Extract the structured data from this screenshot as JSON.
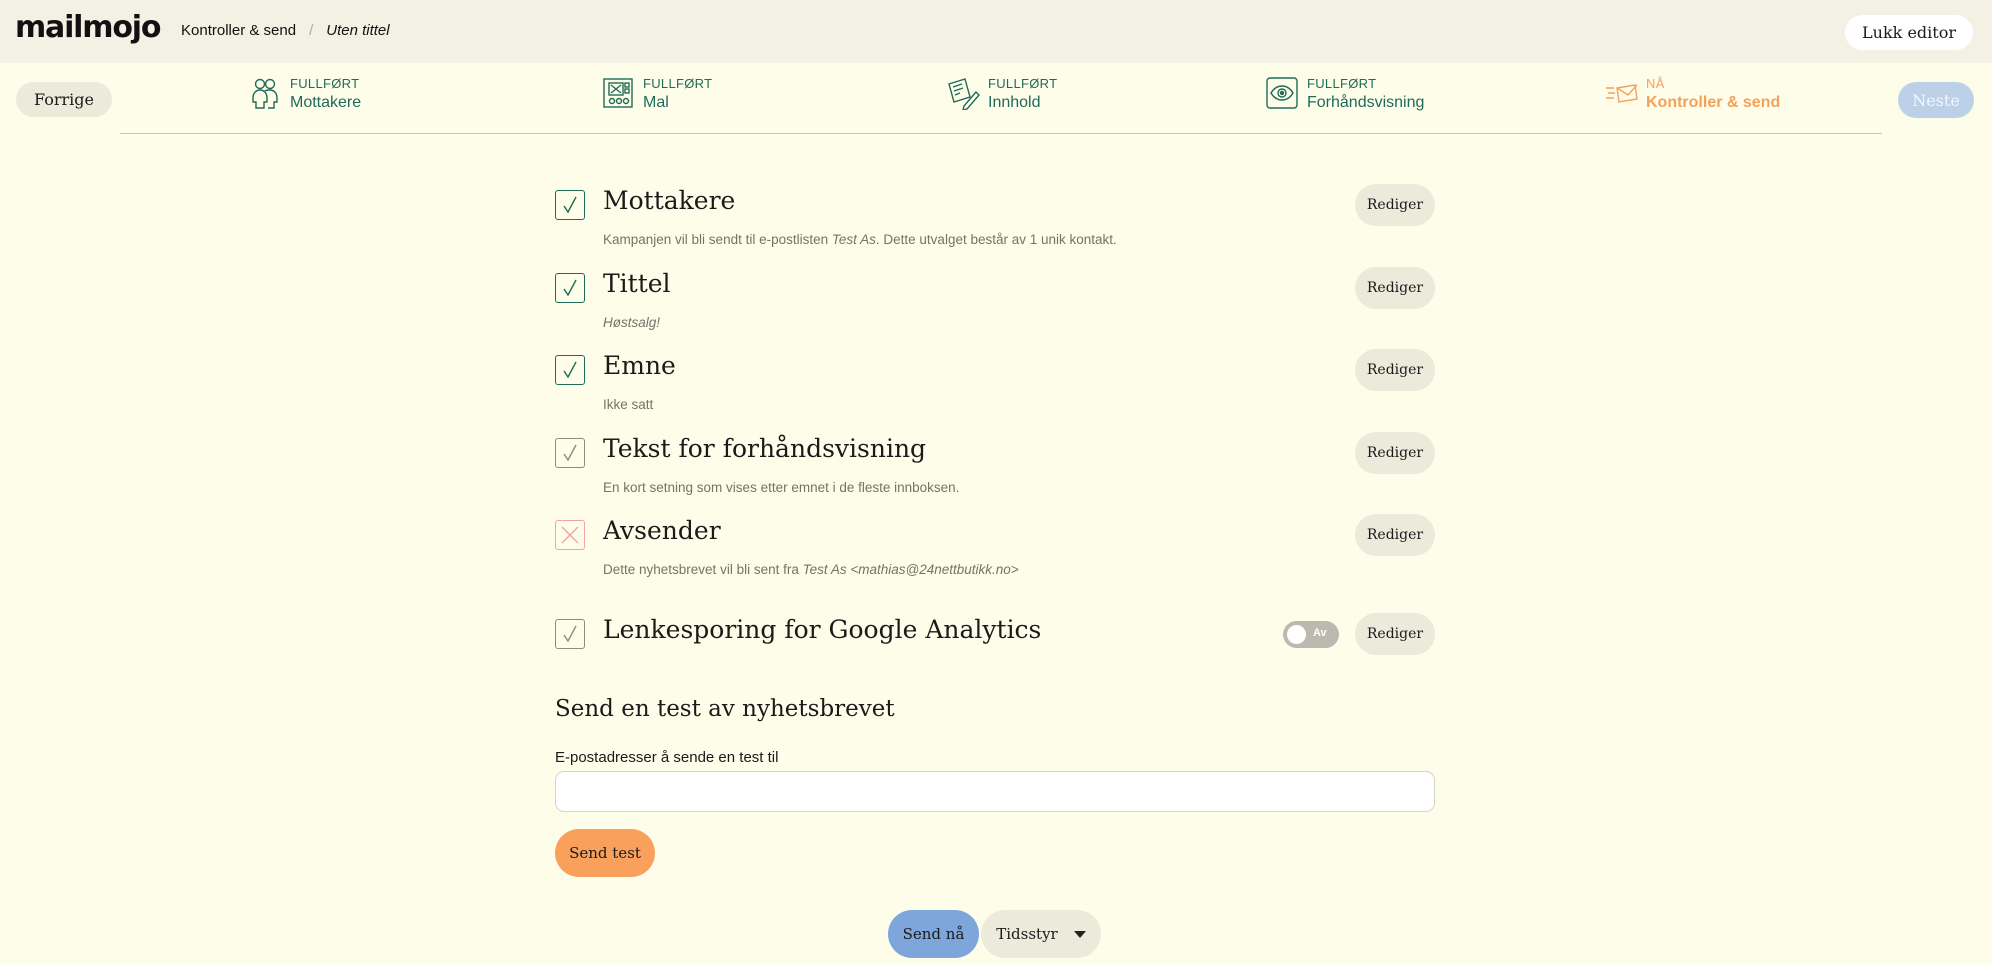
{
  "header": {
    "logo": "mailmojo",
    "breadcrumb": [
      "Kontroller & send",
      "Uten tittel"
    ],
    "close_label": "Lukk editor"
  },
  "nav": {
    "prev_label": "Forrige",
    "next_label": "Neste",
    "steps": [
      {
        "status": "FULLFØRT",
        "label": "Mottakere",
        "icon": "recipients-icon"
      },
      {
        "status": "FULLFØRT",
        "label": "Mal",
        "icon": "template-icon"
      },
      {
        "status": "FULLFØRT",
        "label": "Innhold",
        "icon": "content-icon"
      },
      {
        "status": "FULLFØRT",
        "label": "Forhåndsvisning",
        "icon": "eye-icon"
      },
      {
        "status": "NÅ",
        "label": "Kontroller & send",
        "icon": "send-envelope-icon"
      }
    ]
  },
  "checklist": {
    "edit_label": "Rediger",
    "items": [
      {
        "title": "Mottakere",
        "state": "checked",
        "desc_pre": "Kampanjen vil bli sendt til e-postlisten ",
        "desc_em": "Test As",
        "desc_post": ". Dette utvalget består av 1 unik kontakt."
      },
      {
        "title": "Tittel",
        "state": "checked",
        "desc_pre": "",
        "desc_em": "Høstsalg!",
        "desc_post": ""
      },
      {
        "title": "Emne",
        "state": "checked",
        "desc_pre": "Ikke satt",
        "desc_em": "",
        "desc_post": ""
      },
      {
        "title": "Tekst for forhåndsvisning",
        "state": "optional",
        "desc_pre": "En kort setning som vises etter emnet i de fleste innboksen.",
        "desc_em": "",
        "desc_post": ""
      },
      {
        "title": "Avsender",
        "state": "error",
        "desc_pre": "Dette nyhetsbrevet vil bli sent fra ",
        "desc_em": "Test As <mathias@24nettbutikk.no>",
        "desc_post": ""
      },
      {
        "title": "Lenkesporing for Google Analytics",
        "state": "optional",
        "toggle_label": "Av"
      }
    ]
  },
  "test": {
    "heading": "Send en test av nyhetsbrevet",
    "input_label": "E-postadresser å sende en test til",
    "input_value": "",
    "send_test_label": "Send test"
  },
  "footer": {
    "send_now_label": "Send nå",
    "schedule_label": "Tidsstyr"
  },
  "colors": {
    "background": "#fefdea",
    "done_green": "#1f6b58",
    "current_orange": "#f3a25a",
    "send_now_blue": "#7ea6da",
    "send_test_orange": "#f9a05c",
    "error_red": "#f2a3a3"
  }
}
